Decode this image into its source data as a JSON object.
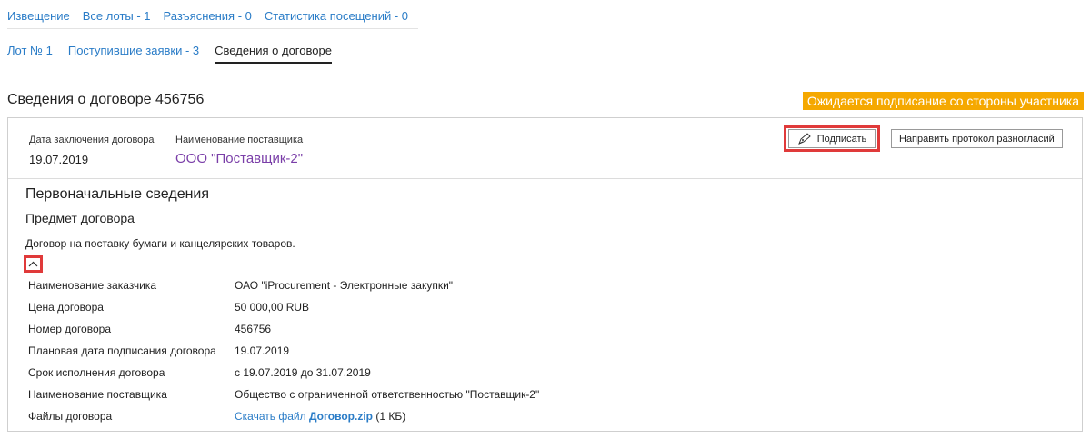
{
  "tabs_top": [
    {
      "label": "Извещение"
    },
    {
      "label": "Все лоты - 1"
    },
    {
      "label": "Разъяснения - 0"
    },
    {
      "label": "Статистика посещений - 0"
    }
  ],
  "tabs_lot": [
    {
      "label": "Лот № 1"
    },
    {
      "label": "Поступившие заявки - 3"
    },
    {
      "label": "Сведения о договоре"
    }
  ],
  "page_title": "Сведения о договоре 456756",
  "status_badge": "Ожидается подписание со стороны участника",
  "header": {
    "date_label": "Дата заключения договора",
    "date_value": "19.07.2019",
    "supplier_label": "Наименование поставщика",
    "supplier_value": "ООО \"Поставщик-2\"",
    "sign_button": "Подписать",
    "protocol_button": "Направить протокол разногласий"
  },
  "section": {
    "title": "Первоначальные сведения",
    "subtitle": "Предмет договора",
    "subject": "Договор на поставку бумаги и канцелярских товаров."
  },
  "details": [
    {
      "key": "Наименование заказчика",
      "value": "ОАО \"iProcurement - Электронные закупки\""
    },
    {
      "key": "Цена договора",
      "value": "50 000,00 RUB"
    },
    {
      "key": "Номер договора",
      "value": "456756"
    },
    {
      "key": "Плановая дата подписания договора",
      "value": "19.07.2019"
    },
    {
      "key": "Срок исполнения договора",
      "value": "с 19.07.2019 до 31.07.2019"
    },
    {
      "key": "Наименование поставщика",
      "value": "Общество с ограниченной ответственностью \"Поставщик-2\""
    }
  ],
  "files": {
    "key": "Файлы договора",
    "download_text": "Скачать файл",
    "file_name": "Договор.zip",
    "file_size": "(1 КБ)"
  },
  "colors": {
    "link": "#2a7cc7",
    "supplier_link": "#7a3ea8",
    "badge": "#f5a800",
    "highlight": "#e03a3a"
  }
}
